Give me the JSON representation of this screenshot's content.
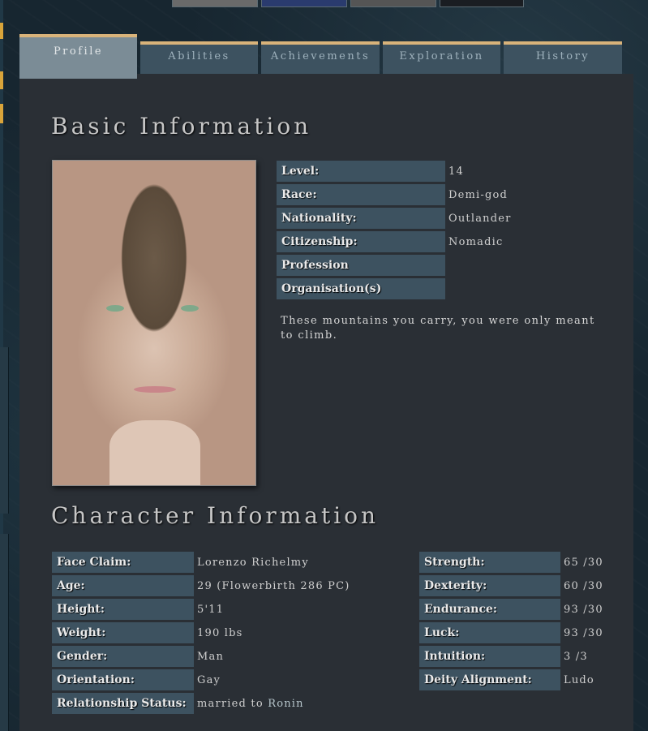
{
  "tabs": [
    {
      "label": "Profile",
      "active": true
    },
    {
      "label": "Abilities",
      "active": false
    },
    {
      "label": "Achievements",
      "active": false
    },
    {
      "label": "Exploration",
      "active": false
    },
    {
      "label": "History",
      "active": false
    }
  ],
  "basic": {
    "heading": "Basic Information",
    "rows": [
      {
        "label": "Level:",
        "value": "14"
      },
      {
        "label": "Race:",
        "value": "Demi-god"
      },
      {
        "label": "Nationality:",
        "value": "Outlander"
      },
      {
        "label": "Citizenship:",
        "value": "Nomadic"
      },
      {
        "label": "Profession",
        "value": ""
      },
      {
        "label": "Organisation(s)",
        "value": ""
      }
    ],
    "quote": "These mountains you carry, you were only meant to climb."
  },
  "character": {
    "heading": "Character Information",
    "left_rows": [
      {
        "label": "Face Claim:",
        "value": "Lorenzo Richelmy"
      },
      {
        "label": "Age:",
        "value": "29 (Flowerbirth 286 PC)"
      },
      {
        "label": "Height:",
        "value": "5'11"
      },
      {
        "label": "Weight:",
        "value": "190 lbs"
      },
      {
        "label": "Gender:",
        "value": "Man"
      },
      {
        "label": "Orientation:",
        "value": "Gay"
      },
      {
        "label": "Relationship Status:",
        "value_prefix": "married to ",
        "value_link": "Ronin"
      }
    ],
    "right_rows": [
      {
        "label": "Strength:",
        "value": "65 /30"
      },
      {
        "label": "Dexterity:",
        "value": "60 /30"
      },
      {
        "label": "Endurance:",
        "value": "93 /30"
      },
      {
        "label": "Luck:",
        "value": "93 /30"
      },
      {
        "label": "Intuition:",
        "value": "3 /3"
      },
      {
        "label": "Deity Alignment:",
        "value": "Ludo"
      }
    ]
  },
  "colors": {
    "tab_accent": "#d9b37a",
    "label_bg": "#3d5260",
    "panel_bg": "#2a2f35"
  }
}
